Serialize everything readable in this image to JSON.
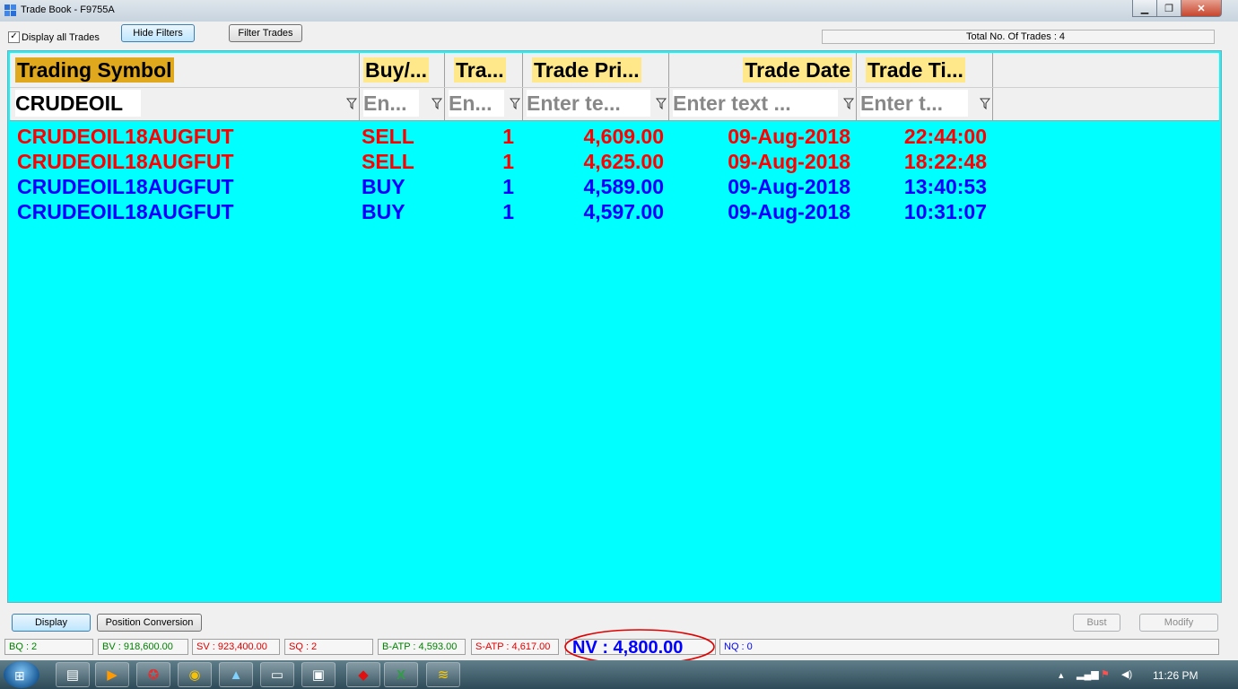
{
  "window": {
    "title": "Trade Book - F9755A"
  },
  "toolbar": {
    "display_all_label": "Display all Trades",
    "display_all_checked": "✓",
    "hide_filters_label": "Hide Filters",
    "filter_trades_label": "Filter Trades",
    "total_trades_text": "Total No. Of Trades : 4"
  },
  "grid": {
    "columns": [
      {
        "label": "Trading Symbol",
        "filter_value": "CRUDEOIL"
      },
      {
        "label": "Buy/...",
        "filter_placeholder": "En..."
      },
      {
        "label": "Tra...",
        "filter_placeholder": "En..."
      },
      {
        "label": "Trade Pri...",
        "filter_placeholder": "Enter te..."
      },
      {
        "label": "Trade Date",
        "filter_placeholder": "Enter text ..."
      },
      {
        "label": "Trade Ti...",
        "filter_placeholder": "Enter t..."
      }
    ],
    "rows": [
      {
        "symbol": "CRUDEOIL18AUGFUT",
        "side": "SELL",
        "qty": "1",
        "price": "4,609.00",
        "date": "09-Aug-2018",
        "time": "22:44:00"
      },
      {
        "symbol": "CRUDEOIL18AUGFUT",
        "side": "SELL",
        "qty": "1",
        "price": "4,625.00",
        "date": "09-Aug-2018",
        "time": "18:22:48"
      },
      {
        "symbol": "CRUDEOIL18AUGFUT",
        "side": "BUY",
        "qty": "1",
        "price": "4,589.00",
        "date": "09-Aug-2018",
        "time": "13:40:53"
      },
      {
        "symbol": "CRUDEOIL18AUGFUT",
        "side": "BUY",
        "qty": "1",
        "price": "4,597.00",
        "date": "09-Aug-2018",
        "time": "10:31:07"
      }
    ]
  },
  "bottom": {
    "display_label": "Display",
    "position_conversion_label": "Position Conversion",
    "bust_label": "Bust",
    "modify_label": "Modify"
  },
  "status": {
    "bq": "BQ : 2",
    "bv": "BV : 918,600.00",
    "sv": "SV : 923,400.00",
    "sq": "SQ : 2",
    "batp": "B-ATP : 4,593.00",
    "satp": "S-ATP : 4,617.00",
    "nv": "NV : 4,800.00",
    "nq": "NQ : 0"
  },
  "colors": {
    "grid_bg": "#00ffff",
    "sell": "#ff0000",
    "buy": "#0000ff",
    "header_bg": "#ffe88a",
    "symbol_header_bg": "#e0a81c"
  },
  "taskbar": {
    "clock": "11:26 PM"
  }
}
